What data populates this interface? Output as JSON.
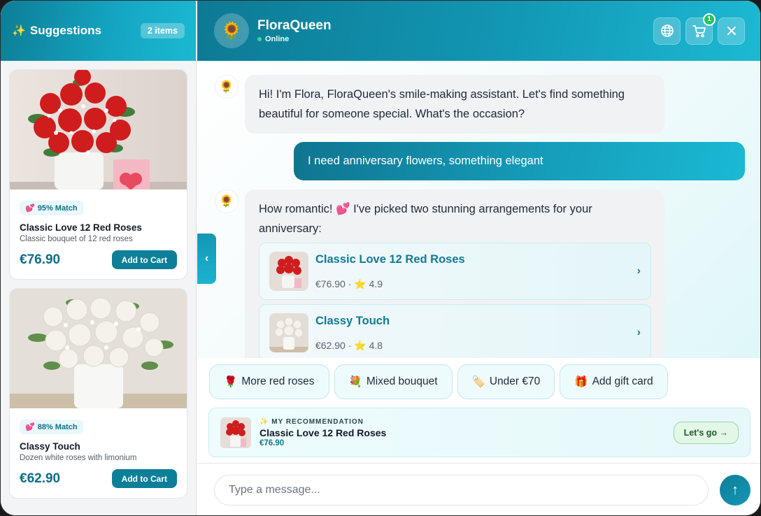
{
  "sidebar": {
    "title": "Suggestions",
    "title_icon": "sparkles-icon",
    "count": "2 items",
    "products": [
      {
        "image": "red-roses-image",
        "match": "95% Match",
        "name": "Classic Love 12 Red Roses",
        "description": "Classic bouquet of 12 red roses",
        "price": "€76.90",
        "button": "Add to Cart"
      },
      {
        "image": "white-roses-image",
        "match": "88% Match",
        "name": "Classy Touch",
        "description": "Dozen white roses with limonium",
        "price": "€62.90",
        "button": "Add to Cart"
      }
    ]
  },
  "header": {
    "avatar": "🌻",
    "brand": "FloraQueen",
    "status": "Online",
    "cart_count": "1",
    "actions": [
      "globe-icon",
      "cart-icon",
      "close-icon"
    ]
  },
  "chat": {
    "bot_avatar": "🌻",
    "messages": [
      {
        "from": "bot",
        "text": "Hi! I'm Flora, FloraQueen's smile-making assistant. Let's find something beautiful for someone special. What's the occasion?"
      },
      {
        "from": "user",
        "text": "I need anniversary flowers, something elegant"
      },
      {
        "from": "bot",
        "text": "How romantic! 💕 I've picked two stunning arrangements for your anniversary:"
      }
    ],
    "recommendations": [
      {
        "name": "Classic Love 12 Red Roses",
        "price": "€76.90",
        "rating": "4.9"
      },
      {
        "name": "Classy Touch",
        "price": "€62.90",
        "rating": "4.8"
      }
    ]
  },
  "chips": [
    {
      "emoji": "🌹",
      "label": "More red roses"
    },
    {
      "emoji": "💐",
      "label": "Mixed bouquet"
    },
    {
      "emoji": "🏷️",
      "label": "Under €70"
    },
    {
      "emoji": "🎁",
      "label": "Add gift card"
    }
  ],
  "recommend_bar": {
    "kicker": "MY RECOMMENDATION",
    "name": "Classic Love 12 Red Roses",
    "price": "€76.90",
    "button": "Let's go →"
  },
  "composer": {
    "placeholder": "Type a message...",
    "send_icon": "↑"
  },
  "colors": {
    "brand_teal": "#0e7f99",
    "accent_cyan": "#1ab9d4",
    "online_green": "#39d98a",
    "cart_badge": "#22c55e"
  }
}
